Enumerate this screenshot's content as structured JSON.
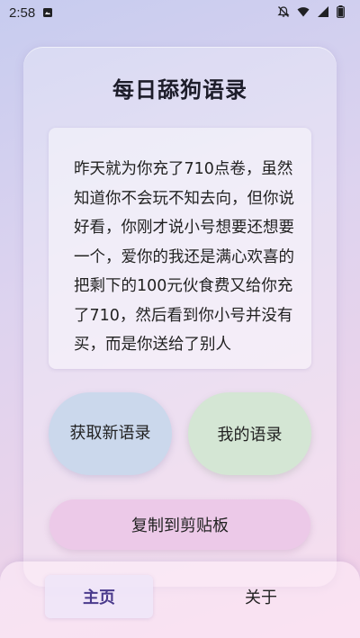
{
  "status_bar": {
    "time": "2:58",
    "icons": [
      "notification-icon",
      "mute-icon",
      "wifi-icon",
      "signal-icon",
      "battery-icon"
    ]
  },
  "title": "每日舔狗语录",
  "quote": "昨天就为你充了710点卷，虽然知道你不会玩不知去向，但你说好看，你刚才说小号想要还想要一个，爱你的我还是满心欢喜的把剩下的100元伙食费又给你充了710，然后看到你小号并没有买，而是你送给了别人",
  "buttons": {
    "new_quote": "获取新语录",
    "my_quotes": "我的语录",
    "copy": "复制到剪贴板"
  },
  "nav": {
    "home": "主页",
    "about": "关于"
  },
  "colors": {
    "accent_nav_text": "#4a3a8c",
    "btn_new_bg": "#cbd8ec",
    "btn_mine_bg": "#d4e6d4",
    "btn_copy_bg": "#ecc9e8"
  }
}
